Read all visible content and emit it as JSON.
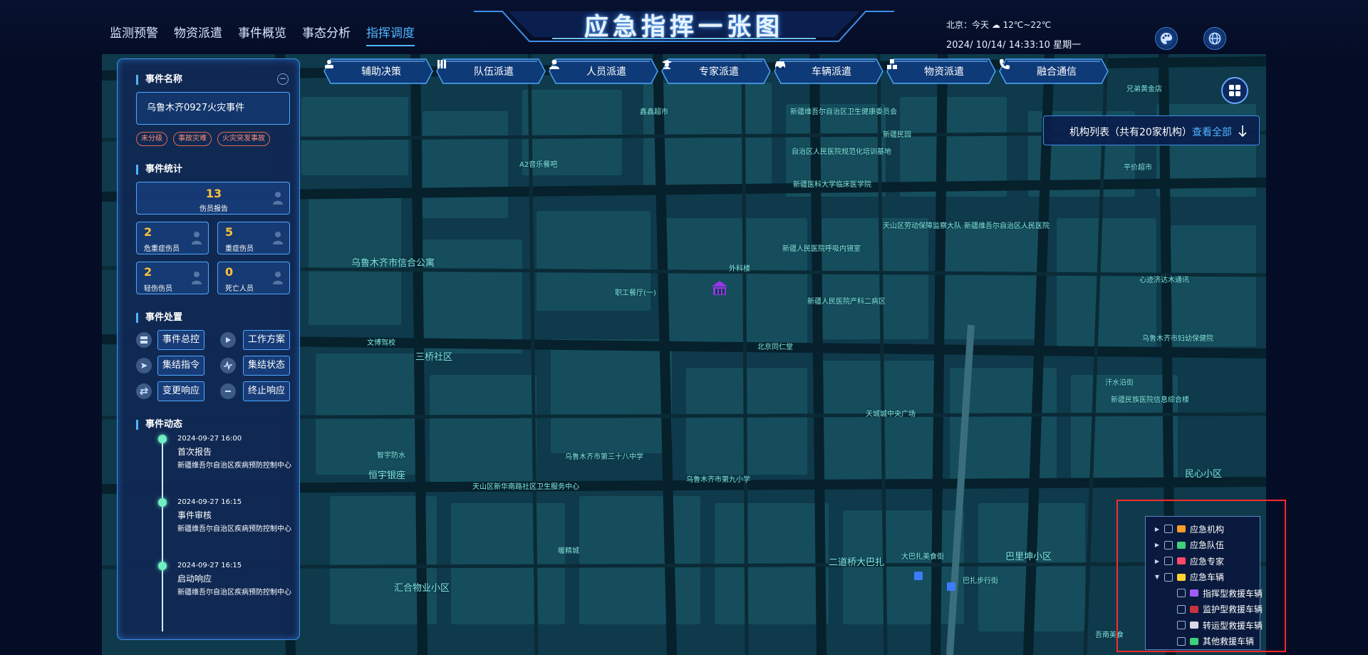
{
  "header": {
    "nav": [
      "监测预警",
      "物资派遣",
      "事件概览",
      "事态分析",
      "指挥调度"
    ],
    "active_nav": "指挥调度",
    "title": "应急指挥一张图",
    "weather": "北京：今天 ☁ 12℃~22℃",
    "datetime": "2024/ 10/14/ 14:33:10 星期一",
    "icons": [
      "palette-icon",
      "globe-icon"
    ]
  },
  "tabs": [
    {
      "label": "辅助决策",
      "icon": "assist-decision-icon"
    },
    {
      "label": "队伍派遣",
      "icon": "team-icon"
    },
    {
      "label": "人员派遣",
      "icon": "person-icon"
    },
    {
      "label": "专家派遣",
      "icon": "expert-icon"
    },
    {
      "label": "车辆派遣",
      "icon": "car-icon"
    },
    {
      "label": "物资派遣",
      "icon": "boxes-icon"
    },
    {
      "label": "融合通信",
      "icon": "phone-icon"
    }
  ],
  "left": {
    "event_name_title": "事件名称",
    "event_name": "乌鲁木齐0927火灾事件",
    "tags": [
      "未分级",
      "事故灾难",
      "火灾突发事故"
    ],
    "stats_title": "事件统计",
    "stats": {
      "total": {
        "value": "13",
        "label": "伤员报告"
      },
      "critical": {
        "value": "2",
        "label": "危重症伤员"
      },
      "serious": {
        "value": "5",
        "label": "重症伤员"
      },
      "minor": {
        "value": "2",
        "label": "轻伤伤员"
      },
      "dead": {
        "value": "0",
        "label": "死亡人员"
      }
    },
    "handling_title": "事件处置",
    "actions": [
      "事件总控",
      "工作方案",
      "集结指令",
      "集结状态",
      "变更响应",
      "终止响应"
    ],
    "timeline_title": "事件动态",
    "timeline": [
      {
        "time": "2024-09-27 16:00",
        "title": "首次报告",
        "org": "新疆维吾尔自治区疾病预防控制中心"
      },
      {
        "time": "2024-09-27 16:15",
        "title": "事件审核",
        "org": "新疆维吾尔自治区疾病预防控制中心"
      },
      {
        "time": "2024-09-27 16:15",
        "title": "启动响应",
        "org": "新疆维吾尔自治区疾病预防控制中心"
      }
    ]
  },
  "org_list": {
    "title": "机构列表（共有20家机构）",
    "link": "查看全部"
  },
  "layers": [
    {
      "label": "应急机构",
      "color": "#ff9b2b",
      "group": true,
      "expanded": false
    },
    {
      "label": "应急队伍",
      "color": "#3fd07a",
      "group": true,
      "expanded": false
    },
    {
      "label": "应急专家",
      "color": "#ff4a6a",
      "group": true,
      "expanded": false
    },
    {
      "label": "应急车辆",
      "color": "#ffd233",
      "group": true,
      "expanded": true
    },
    {
      "label": "指挥型救援车辆",
      "color": "#a35bff",
      "group": false
    },
    {
      "label": "监护型救援车辆",
      "color": "#c8323c",
      "group": false
    },
    {
      "label": "转运型救援车辆",
      "color": "#d8d8e8",
      "group": false
    },
    {
      "label": "其他救援车辆",
      "color": "#3fd07a",
      "group": false
    }
  ],
  "map_labels": [
    "新疆维吾尔自治区卫生健康委员会",
    "新疆民园",
    "新疆维吾尔自治区人民医院",
    "乌鲁木齐市信合公寓",
    "三桥社区",
    "恒宇银座",
    "汇合物业小区",
    "二道桥大巴扎",
    "巴里坤小区",
    "民心小区",
    "新疆人民医院呼吸内镜室",
    "新疆人民医院产科二病区",
    "外科楼",
    "北京同仁堂",
    "新疆医科大学临床医学院",
    "天山区劳动保障监察大队",
    "乌鲁木齐市第三十八中学",
    "乌鲁木齐市第九小学",
    "天山区新华南路社区卫生服务中心",
    "乌鲁木齐市妇幼保健院",
    "新疆民族医院信息综合楼",
    "天城城中央广场",
    "自治区人民医院规范化培训基地",
    "兄弟黄金店",
    "汗水沿街",
    "心迹济达木通讯",
    "鑫鑫超市",
    "平价超市",
    "A2音乐餐吧",
    "职工餐厅(一)",
    "文博驾校",
    "智宇防水",
    "暖精城",
    "吾南美食",
    "大巴扎美食街",
    "巴扎步行街"
  ]
}
